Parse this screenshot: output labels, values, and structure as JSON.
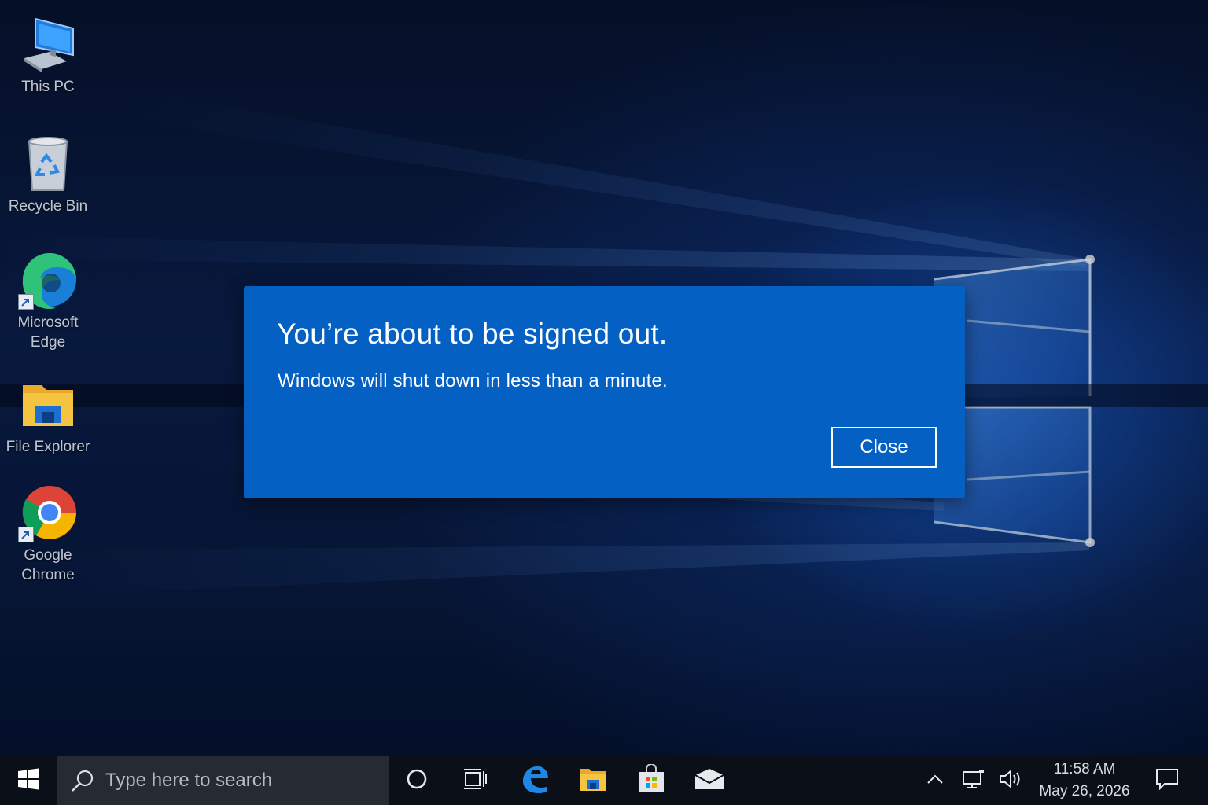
{
  "desktop": {
    "icons": [
      {
        "label": "This PC",
        "icon": "this-pc-icon"
      },
      {
        "label": "Recycle Bin",
        "icon": "recycle-bin-icon"
      },
      {
        "label": "Microsoft Edge",
        "icon": "edge-icon"
      },
      {
        "label": "File Explorer",
        "icon": "file-explorer-icon"
      },
      {
        "label": "Google Chrome",
        "icon": "chrome-icon"
      }
    ]
  },
  "dialog": {
    "title": "You’re about to be signed out.",
    "message": "Windows will shut down in less than a minute.",
    "close_label": "Close",
    "background": "#0560c4"
  },
  "taskbar": {
    "search_placeholder": "Type here to search",
    "pinned": [
      "cortana-icon",
      "task-view-icon",
      "edge-icon",
      "file-explorer-icon",
      "store-icon",
      "mail-icon"
    ],
    "clock": {
      "time": "11:58 AM",
      "date": "May 26, 2026"
    },
    "background": "#0b0f17"
  }
}
